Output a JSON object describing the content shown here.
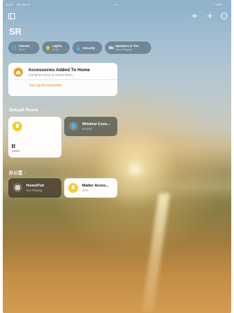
{
  "status_bar": {
    "time": "16:33",
    "date": "Tue Jun 27",
    "battery": "80%"
  },
  "header": {
    "title": "SR"
  },
  "chips": [
    {
      "label": "Climate",
      "sub": "28.5°"
    },
    {
      "label": "Lights",
      "sub": "2 On"
    },
    {
      "label": "Security",
      "sub": ""
    },
    {
      "label": "Speakers & TVs",
      "sub": "None Playing"
    }
  ],
  "banner": {
    "title": "Accessories Added To Home",
    "subtitle": "Complete setup to control them.",
    "link": "Set Up Accessories"
  },
  "sections": {
    "default_room": "Default Room",
    "office": "办公室"
  },
  "tiles": {
    "light_value": "100%",
    "window_name": "Window Cove...",
    "window_status": "Closed",
    "homepod_name": "HomePod",
    "homepod_status": "Not Playing",
    "matter_name": "Matter Acces...",
    "matter_status": "37%"
  },
  "colors": {
    "accent": "#f29a17",
    "bulb": "#f7cc2a",
    "window_icon": "#4fb3e8"
  },
  "icons": [
    "sidebar-icon",
    "waveform-icon",
    "plus-icon",
    "more-icon",
    "home-icon",
    "bulb-icon",
    "window-covering-icon",
    "homepod-icon",
    "speaker-icon"
  ]
}
